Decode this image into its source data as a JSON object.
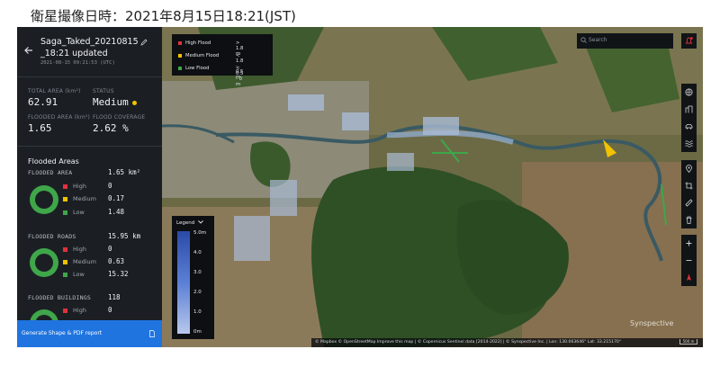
{
  "caption": "衛星撮像日時：2021年8月15日18:21(JST)",
  "sidebar": {
    "title_line1": "Saga_Taked_20210815",
    "title_line2": "_18:21 updated",
    "updated_at": "2021-08-15 09:21:53 (UTC)",
    "stats": {
      "total_area_label": "TOTAL AREA (km²)",
      "total_area_value": "62.91",
      "status_label": "STATUS",
      "status_value": "Medium",
      "flooded_area_label": "FLOODED AREA (km²)",
      "flooded_area_value": "1.65",
      "coverage_label": "FLOOD COVERAGE",
      "coverage_value": "2.62 %"
    },
    "flooded_areas_heading": "Flooded Areas",
    "categories": [
      {
        "label": "FLOODED AREA",
        "value": "1.65 km²",
        "high": "0",
        "medium": "0.17",
        "low": "1.48"
      },
      {
        "label": "FLOODED ROADS",
        "value": "15.95 km",
        "high": "0",
        "medium": "0.63",
        "low": "15.32"
      },
      {
        "label": "FLOODED BUILDINGS",
        "value": "118",
        "high": "0",
        "medium": "",
        "low": ""
      }
    ],
    "level_names": {
      "high": "High",
      "medium": "Medium",
      "low": "Low"
    },
    "generate_button": "Generate Shape & PDF report"
  },
  "map": {
    "flood_legend": [
      {
        "name": "High Flood",
        "range": "> 1.8 m",
        "color": "#e0323b"
      },
      {
        "name": "Medium Flood",
        "range": "< 1.8 - 0.5 m",
        "color": "#f2c200"
      },
      {
        "name": "Low Flood",
        "range": "< 0.5 - 0 m",
        "color": "#3fa64a"
      }
    ],
    "depth_legend": {
      "title": "Legend",
      "ticks": [
        "5.0m",
        "4.0",
        "3.0",
        "2.0",
        "1.0",
        "0m"
      ]
    },
    "search_placeholder": "Search",
    "watermark": "Synspective",
    "attribution": "© Mapbox  © OpenStreetMap  Improve this map  | © Copernicus Sentinel data [2014-2022] | © Synspective Inc. | Lon: 130.063646° Lat: 33.215170°",
    "scale": "500 m"
  },
  "colors": {
    "accent": "#1f74e0",
    "sidebar": "#1b1f24",
    "high": "#e0323b",
    "medium": "#f2c200",
    "low": "#3fa64a"
  }
}
